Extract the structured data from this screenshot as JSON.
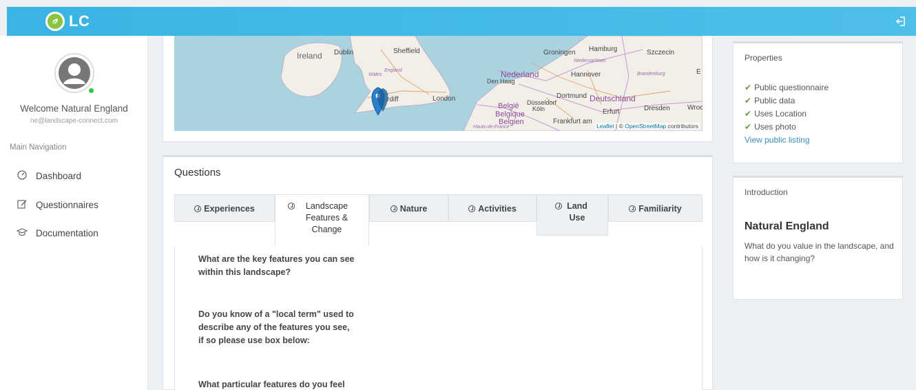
{
  "brand": {
    "logo_text": "LC"
  },
  "user": {
    "welcome": "Welcome Natural England",
    "email": "ne@landscape-connect.com"
  },
  "nav": {
    "heading": "Main Navigation",
    "items": [
      {
        "label": "Dashboard",
        "icon": "dashboard-icon"
      },
      {
        "label": "Questionnaires",
        "icon": "edit-icon"
      },
      {
        "label": "Documentation",
        "icon": "graduation-cap-icon"
      }
    ]
  },
  "map": {
    "labels": [
      "Ireland",
      "Dublin",
      "Sheffield",
      "Wales",
      "England",
      "rdiff",
      "London",
      "Groningen",
      "Hamburg",
      "Szczecin",
      "Niedersachsen",
      "Nederland",
      "Hannover",
      "Brandenburg",
      "Den Haag",
      "Dortmund",
      "Deutschland",
      "België",
      "Düsseldorf",
      "Köln",
      "Erfurt",
      "Dresden",
      "Wroc",
      "Belgique",
      "Belgien",
      "Frankfurt am",
      "Hauts-de-France",
      "E"
    ],
    "attribution_link1": "Leaflet",
    "attribution_sep": " | © ",
    "attribution_link2": "OpenStreetMap",
    "attribution_tail": " contributors"
  },
  "questions": {
    "title": "Questions",
    "tabs": [
      {
        "label": "Experiences"
      },
      {
        "label": "Landscape Features & Change"
      },
      {
        "label": "Nature"
      },
      {
        "label": "Activities"
      },
      {
        "label": "Land Use"
      },
      {
        "label": "Familiarity"
      }
    ],
    "active_tab": "Landscape Features & Change",
    "items": [
      "What are the key features you can see within this landscape?",
      "Do you know of a \"local term\" used to describe any of the features you see, if so please use box below:",
      "What particular features do you feel"
    ]
  },
  "properties": {
    "heading": "Properties",
    "items": [
      "Public questionnaire",
      "Public data",
      "Uses Location",
      "Uses photo"
    ],
    "link": "View public listing"
  },
  "introduction": {
    "heading": "Introduction",
    "title": "Natural England",
    "text": "What do you value in the landscape, and how is it changing?"
  },
  "colors": {
    "topbar": "#3bb4e3",
    "logo_green": "#8bc53f",
    "link": "#3c8dbc",
    "marker": "#2a81cb"
  }
}
